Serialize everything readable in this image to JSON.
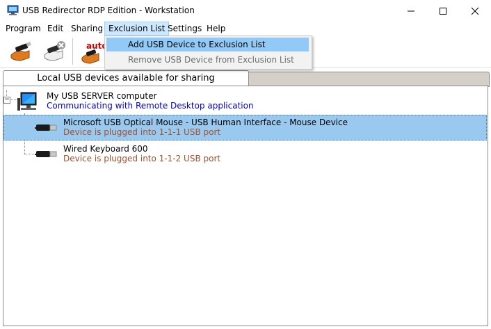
{
  "window": {
    "title": "USB Redirector RDP Edition - Workstation"
  },
  "menubar": {
    "items": [
      "Program",
      "Edit",
      "Sharing",
      "Exclusion List",
      "Settings",
      "Help"
    ]
  },
  "toolbar": {
    "auto_label": "auto"
  },
  "dropdown": {
    "items": [
      {
        "label": "Add USB Device to Exclusion List",
        "enabled": true
      },
      {
        "label": "Remove USB Device from Exclusion List",
        "enabled": false
      }
    ]
  },
  "tabs": {
    "active": "Local USB devices available for sharing"
  },
  "tree": {
    "root": {
      "name": "My USB SERVER computer",
      "status": "Communicating with Remote Desktop application"
    },
    "devices": [
      {
        "name": "Microsoft USB Optical Mouse - USB Human Interface - Mouse Device",
        "status": "Device is plugged into 1-1-1 USB port",
        "selected": true
      },
      {
        "name": "Wired Keyboard 600",
        "status": "Device is plugged into 1-1-2 USB port",
        "selected": false
      }
    ]
  },
  "colors": {
    "link_blue": "#0000e6",
    "status_brown": "#a0522d",
    "selection": "#99c9ef",
    "menu_highlight": "#91c9f7"
  }
}
